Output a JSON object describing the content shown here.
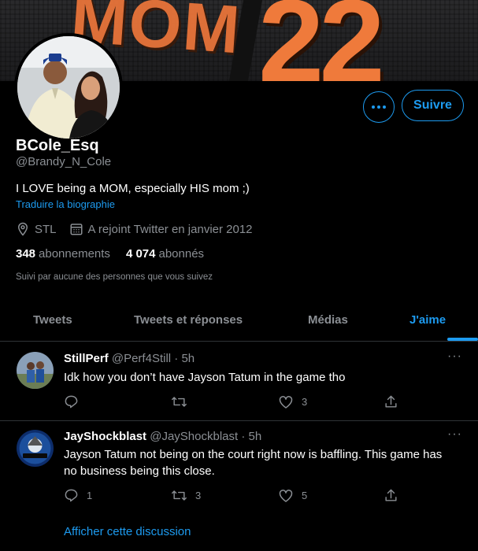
{
  "banner": {
    "jersey_text": "MOM",
    "jersey_number": "22"
  },
  "profile": {
    "display_name": "BCole_Esq",
    "handle": "@Brandy_N_Cole",
    "bio": "I LOVE being a MOM, especially HIS mom ;)",
    "translate_label": "Traduire la biographie",
    "location": "STL",
    "joined": "A rejoint Twitter en janvier 2012",
    "following_count": "348",
    "following_label": "abonnements",
    "followers_count": "4 074",
    "followers_label": "abonnés",
    "followed_by": "Suivi par aucune des personnes que vous suivez",
    "follow_label": "Suivre"
  },
  "tabs": [
    {
      "label": "Tweets"
    },
    {
      "label": "Tweets et réponses"
    },
    {
      "label": "Médias"
    },
    {
      "label": "J'aime",
      "active": true
    }
  ],
  "tweets": [
    {
      "display_name": "StillPerf",
      "meta": "@Perf4Still · 5h",
      "text": "Idk how you don’t have Jayson Tatum in the game tho",
      "replies": "",
      "retweets": "",
      "likes": "3"
    },
    {
      "display_name": "JayShockblast",
      "meta": "@JayShockblast · 5h",
      "text": "Jayson Tatum not being on the court right now is baffling. This game has no business being this close.",
      "replies": "1",
      "retweets": "3",
      "likes": "5"
    }
  ],
  "show_thread_label": "Afficher cette discussion",
  "colors": {
    "accent": "#1d9bf0",
    "background": "#000000",
    "secondary_text": "#8b8f94",
    "divider": "#2f3336"
  }
}
